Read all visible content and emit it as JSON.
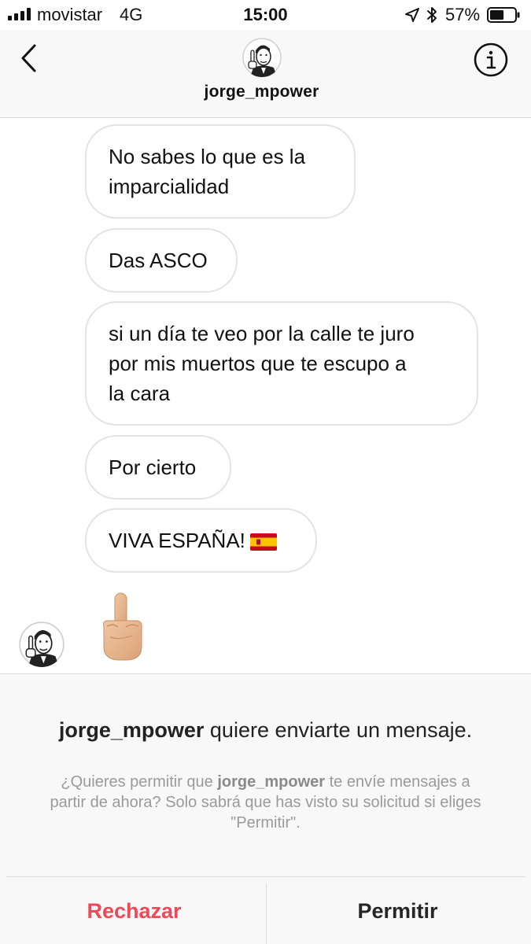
{
  "status_bar": {
    "carrier": "movistar",
    "network": "4G",
    "time": "15:00",
    "battery_percent": "57%",
    "battery_level": 0.57,
    "icons": [
      "signal-icon",
      "location-icon",
      "bluetooth-icon",
      "battery-icon"
    ]
  },
  "header": {
    "username": "jorge_mpower",
    "back_icon": "chevron-left-icon",
    "info_icon": "info-icon"
  },
  "messages": [
    {
      "lines": [
        "No sabes lo que es la",
        "imparcialidad"
      ]
    },
    {
      "lines": [
        "Das ASCO"
      ]
    },
    {
      "lines": [
        "si un día te veo por la calle te juro",
        "por mis muertos que te escupo a",
        "la cara"
      ]
    },
    {
      "lines": [
        "Por cierto"
      ]
    },
    {
      "lines": [
        "VIVA ESPAÑA!"
      ],
      "emoji": "spain-flag-icon"
    }
  ],
  "last_message_emoji": "middle-finger-emoji",
  "request": {
    "title_user": "jorge_mpower",
    "title_rest": " quiere enviarte un mensaje.",
    "desc_part1": "¿Quieres permitir que ",
    "desc_user": "jorge_mpower",
    "desc_part2": " te envíe mensajes a partir de ahora? Solo sabrá que has visto su solicitud si eliges \"Permitir\".",
    "reject_label": "Rechazar",
    "allow_label": "Permitir"
  },
  "colors": {
    "reject": "#ed4956",
    "bubble_border": "#e3e3e3",
    "panel_bg": "#f8f8f8",
    "desc_text": "#9a9a9a"
  }
}
